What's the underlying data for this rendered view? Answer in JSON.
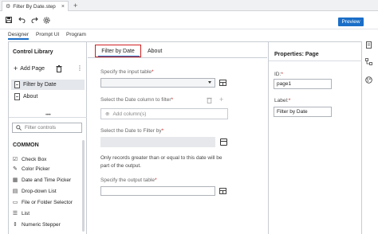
{
  "window": {
    "tab_title": "Filter By Date.step",
    "close_glyph": "×",
    "add_tab_glyph": "+"
  },
  "toolbar": {
    "preview_label": "Preview",
    "icons": [
      "save-icon",
      "undo-icon",
      "redo-icon",
      "settings-icon"
    ]
  },
  "view_tabs": [
    "Designer",
    "Prompt UI",
    "Program"
  ],
  "control_library": {
    "title": "Control Library",
    "add_page_label": "Add Page",
    "more_glyph": "⋮",
    "pages": [
      "Filter by Date",
      "About"
    ],
    "splitter_glyph": "••••",
    "filter_placeholder": "Filter controls",
    "section_header": "COMMON",
    "controls": [
      {
        "label": "Check Box",
        "icon": "checkbox-icon"
      },
      {
        "label": "Color Picker",
        "icon": "color-picker-icon"
      },
      {
        "label": "Date and Time Picker",
        "icon": "calendar-icon"
      },
      {
        "label": "Drop-down List",
        "icon": "dropdown-list-icon"
      },
      {
        "label": "File or Folder Selector",
        "icon": "folder-icon"
      },
      {
        "label": "List",
        "icon": "list-icon"
      },
      {
        "label": "Numeric Stepper",
        "icon": "numeric-stepper-icon"
      }
    ]
  },
  "canvas": {
    "tabs": [
      "Filter by Date",
      "About"
    ],
    "input_table_label": "Specify the input table",
    "date_column_label": "Select the Date column to filter",
    "add_columns_placeholder": "Add column(s)",
    "date_filter_label": "Select the Date to Filter by",
    "note": "Only records greater than or equal to this date will be part of the output.",
    "output_table_label": "Specify the output table",
    "required_marker": "*"
  },
  "properties": {
    "title": "Properties: Page",
    "id_label": "ID:",
    "id_value": "page1",
    "label_label": "Label:",
    "label_value": "Filter by Date",
    "required_marker": "*"
  }
}
